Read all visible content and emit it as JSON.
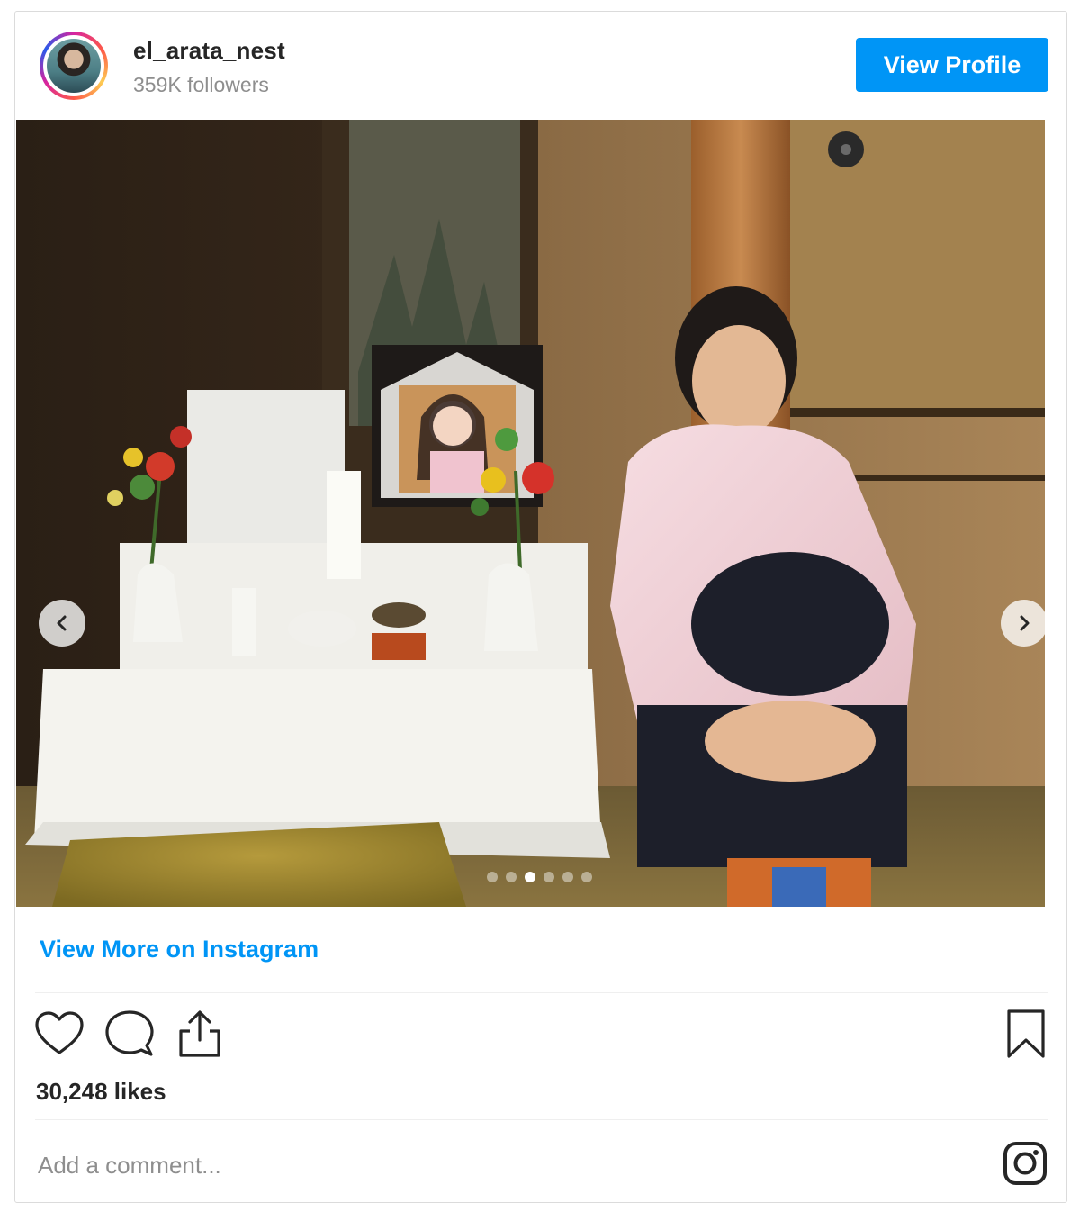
{
  "header": {
    "username": "el_arata_nest",
    "followers": "359K followers",
    "view_profile_label": "View Profile"
  },
  "carousel": {
    "slide_count": 6,
    "active_index": 2
  },
  "view_more_label": "View More on Instagram",
  "likes": "30,248 likes",
  "comment": {
    "placeholder": "Add a comment..."
  },
  "colors": {
    "accent": "#0095f6",
    "text": "#262626",
    "muted": "#8e8e8e",
    "border": "#dbdbdb"
  },
  "icons": [
    "heart-icon",
    "comment-icon",
    "share-icon",
    "bookmark-icon",
    "instagram-icon",
    "chevron-left-icon",
    "chevron-right-icon"
  ]
}
